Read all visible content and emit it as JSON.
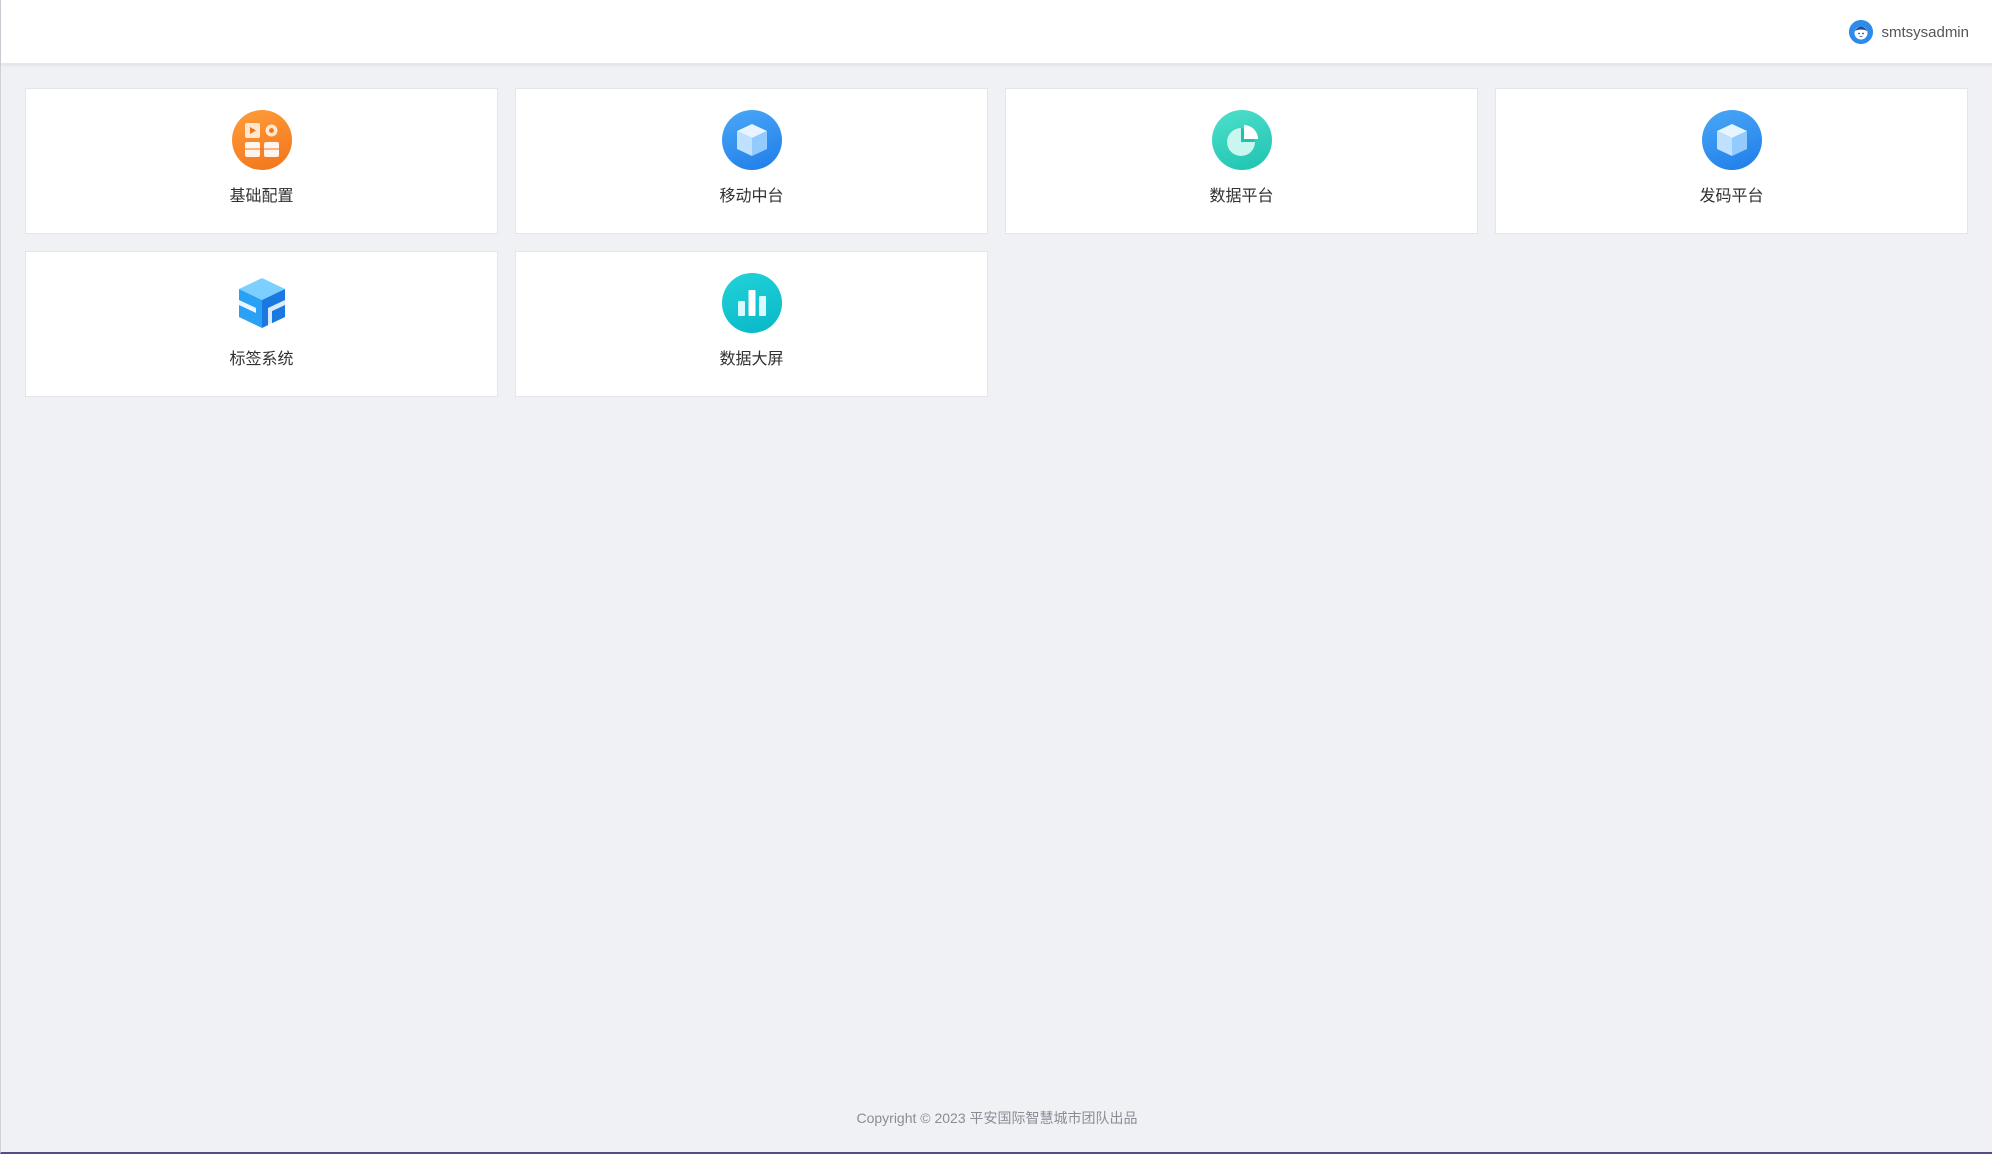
{
  "header": {
    "username": "smtsysadmin",
    "avatar_icon": "user-avatar-icon"
  },
  "apps": [
    {
      "label": "基础配置",
      "icon": "config-apps-icon",
      "color": "#f2741a"
    },
    {
      "label": "移动中台",
      "icon": "cube-icon",
      "color": "#1f7ce8"
    },
    {
      "label": "数据平台",
      "icon": "pie-chart-icon",
      "color": "#1cc3b0"
    },
    {
      "label": "发码平台",
      "icon": "cube-icon",
      "color": "#1f7ce8"
    },
    {
      "label": "标签系统",
      "icon": "stacked-blocks-icon",
      "color": "#1f7ce8"
    },
    {
      "label": "数据大屏",
      "icon": "bar-chart-icon",
      "color": "#08b7c7"
    }
  ],
  "footer": {
    "copyright": "Copyright © 2023 平安国际智慧城市团队出品"
  }
}
